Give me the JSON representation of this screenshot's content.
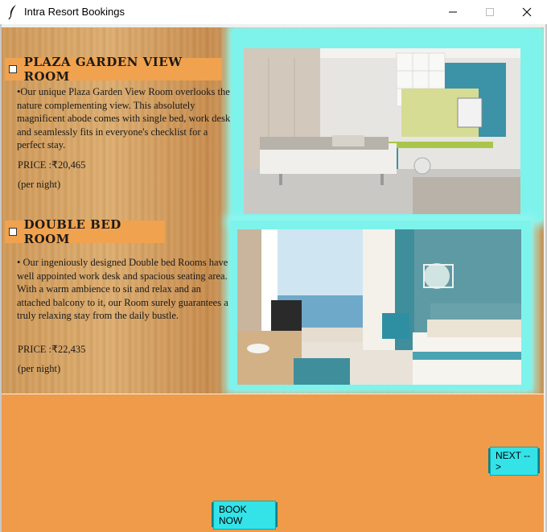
{
  "window": {
    "title": "Intra Resort Bookings",
    "controls": [
      "minimize",
      "maximize",
      "close"
    ]
  },
  "rooms": [
    {
      "name": "PLAZA GARDEN VIEW ROOM",
      "description": "•Our unique Plaza Garden View Room overlooks the nature complementing view. This absolutely magnificent abode comes with single bed, work desk and seamlessly fits in everyone's checklist for a perfect stay.",
      "price": "PRICE :₹20,465",
      "per": "(per night)",
      "checked": false
    },
    {
      "name": "DOUBLE BED ROOM",
      "description": "• Our ingeniously designed Double bed Rooms have well appointed work desk and spacious seating area. With a warm ambience to sit and relax and an attached balcony to it, our Room surely guarantees a truly relaxing stay from the daily bustle.",
      "price": "PRICE :₹22,435",
      "per": "(per night)",
      "checked": false
    }
  ],
  "buttons": {
    "next": "NEXT -->",
    "book_now": "BOOK NOW"
  },
  "colors": {
    "accent_orange": "#ef9b49",
    "button_cyan": "#1ccfd6",
    "glow_cyan": "#7ef3ec"
  }
}
